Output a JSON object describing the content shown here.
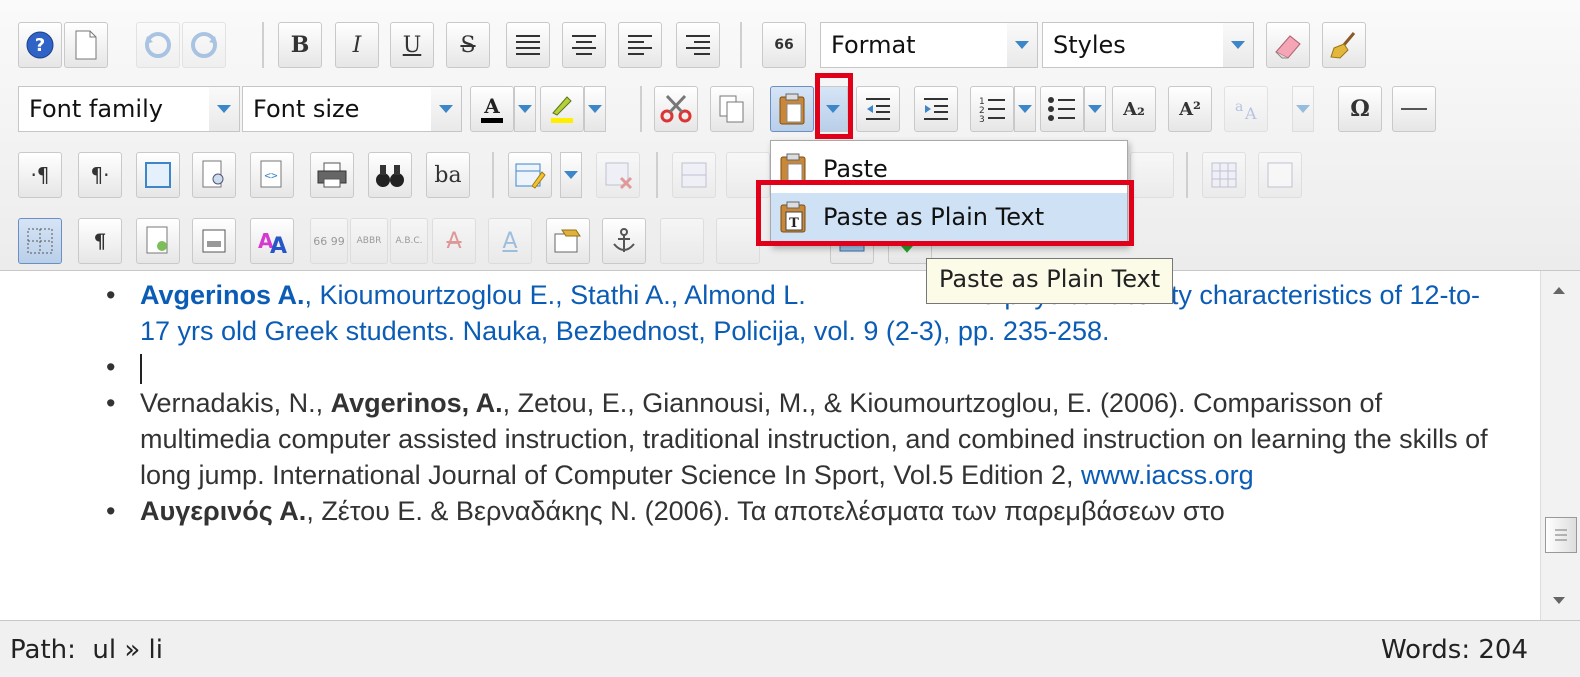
{
  "toolbar": {
    "row1": {
      "icons": [
        "help-icon",
        "new-document-icon",
        "undo-icon",
        "redo-icon",
        "bold-icon",
        "italic-icon",
        "underline-icon",
        "strikethrough-icon",
        "justify-full-icon",
        "align-center-icon",
        "align-left-icon",
        "align-right-icon",
        "blockquote-icon"
      ],
      "bold_label": "B",
      "italic_label": "I",
      "underline_label": "U",
      "strike_label": "S",
      "quote_label": "66",
      "format_label": "Format",
      "styles_label": "Styles"
    },
    "row2": {
      "font_family_label": "Font family",
      "font_size_label": "Font size",
      "subscript_label": "A₂",
      "superscript_label": "A²",
      "special_char_label": "Ω"
    },
    "row3": {
      "ba_label": "ba"
    },
    "row4": {
      "cite_label": "66 99",
      "abbr_label": "ABBR",
      "acronym_label": "A.B.C.",
      "styleprops_label": "A",
      "attribs_label": "A"
    }
  },
  "paste_menu": {
    "items": [
      {
        "label": "Paste",
        "icon": "paste-icon"
      },
      {
        "label": "Paste as Plain Text",
        "icon": "paste-text-icon"
      }
    ]
  },
  "tooltip": "Paste as Plain Text",
  "content": {
    "items": [
      {
        "bold": "Avgerinos A.",
        "text": ", Kioumourtzoglou E., Stathi A., Almond L.",
        "tail": "d physical activity characteristics of 12-to-17 yrs old Greek students. Nauka, Bezbednost, Policija, vol. 9 (2-3), pp. 235-258."
      },
      {
        "text": ""
      },
      {
        "pre": "Vernadakis, N., ",
        "bold": "Avgerinos, A.",
        "text": ", Zetou, E., Giannousi, M., & Kioumourtzoglou, E. (2006). Comparisson of multimedia computer assisted instruction, traditional instruction, and combined instruction on learning the skills of long jump. International Journal of Computer Science In Sport, Vol.5 Edition 2, ",
        "link": "www.iacss.org"
      },
      {
        "bold": "Αυγερινός Α.",
        "text": ", Ζέτου Ε. & Βερναδάκης Ν. (2006). Τα αποτελέσματα των παρεμβάσεων στο"
      }
    ]
  },
  "status": {
    "path_label": "Path:",
    "path_value": "ul » li",
    "words": "Words: 204"
  },
  "colors": {
    "highlight_red": "#e0001a",
    "link_blue": "#0b5cb5",
    "menu_highlight": "#cfe2f5"
  }
}
